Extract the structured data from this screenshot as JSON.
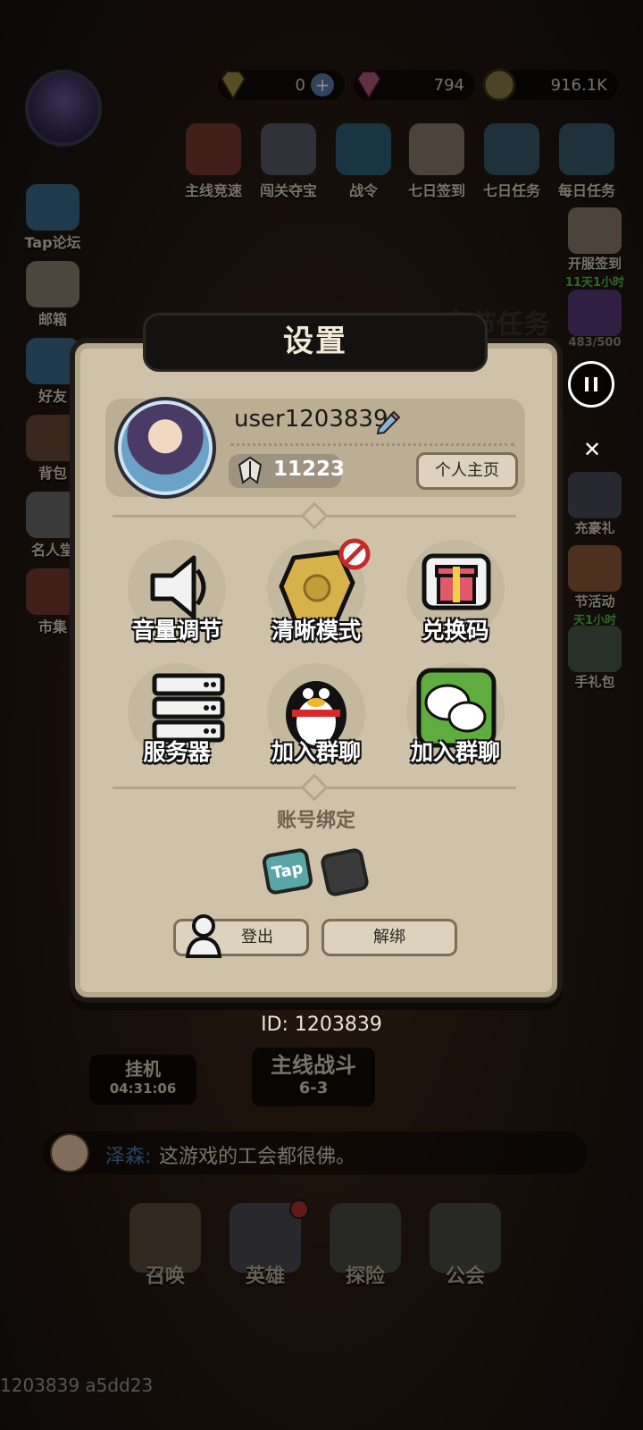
{
  "currencies": [
    {
      "name": "gold-diamond",
      "value": "0"
    },
    {
      "name": "pink-gem",
      "value": "794"
    },
    {
      "name": "coin",
      "value": "916.1K"
    }
  ],
  "top_menu": [
    {
      "label": "主线竞速",
      "icon": "trophy-icon"
    },
    {
      "label": "闯关夺宝",
      "icon": "wolf-icon"
    },
    {
      "label": "战令",
      "icon": "scroll-icon"
    },
    {
      "label": "七日签到",
      "icon": "calendar-icon"
    },
    {
      "label": "七日任务",
      "icon": "helmet-icon"
    },
    {
      "label": "每日任务",
      "icon": "clipboard-icon"
    }
  ],
  "left_menu": [
    {
      "label": "Tap论坛",
      "icon": "chat-bubble-icon"
    },
    {
      "label": "邮箱",
      "icon": "envelope-icon"
    },
    {
      "label": "好友",
      "icon": "friend-icon"
    },
    {
      "label": "背包",
      "icon": "backpack-icon"
    },
    {
      "label": "名人堂",
      "icon": "shield-icon"
    },
    {
      "label": "市集",
      "icon": "market-icon"
    }
  ],
  "right_menu": [
    {
      "label": "开服签到",
      "sub": "11天1小时",
      "icon": "calendar-icon"
    },
    {
      "label": "",
      "sub": "483/500",
      "icon": "grid-icon"
    },
    {
      "label": "充豪礼",
      "sub": "",
      "icon": "ssr-icon"
    },
    {
      "label": "节活动",
      "sub": "天1小时",
      "icon": "festival-icon"
    },
    {
      "label": "手礼包",
      "sub": "",
      "icon": "gift-pack-icon"
    }
  ],
  "bg_overlay_text": "章节任务",
  "dialog": {
    "title": "设置",
    "username": "user1203839",
    "power": "11223",
    "home_button": "个人主页",
    "settings": [
      {
        "label": "音量调节",
        "icon": "speaker-icon"
      },
      {
        "label": "清晰模式",
        "icon": "quality-gem-icon"
      },
      {
        "label": "兑换码",
        "icon": "gift-icon"
      },
      {
        "label": "服务器",
        "icon": "server-icon"
      },
      {
        "label": "加入群聊",
        "icon": "qq-penguin-icon"
      },
      {
        "label": "加入群聊",
        "icon": "wechat-icon"
      }
    ],
    "bind_label": "账号绑定",
    "bind_options": [
      {
        "label": "Tap",
        "icon": "tap-icon"
      },
      {
        "label": "",
        "icon": "phone-icon"
      }
    ],
    "logout": "登出",
    "unbind": "解绑"
  },
  "user_id": "ID: 1203839",
  "idle": {
    "title": "挂机",
    "time": "04:31:06"
  },
  "main_battle": {
    "title": "主线战斗",
    "stage": "6-3"
  },
  "chat": {
    "name": "泽森:",
    "message": "这游戏的工会都很佛。"
  },
  "bottom_nav": [
    {
      "label": "召唤",
      "icon": "helmet-icon"
    },
    {
      "label": "英雄",
      "icon": "hero-crest-icon"
    },
    {
      "label": "探险",
      "icon": "compass-icon"
    },
    {
      "label": "公会",
      "icon": "star-shield-icon"
    }
  ],
  "footer": "1203839 a5dd23"
}
